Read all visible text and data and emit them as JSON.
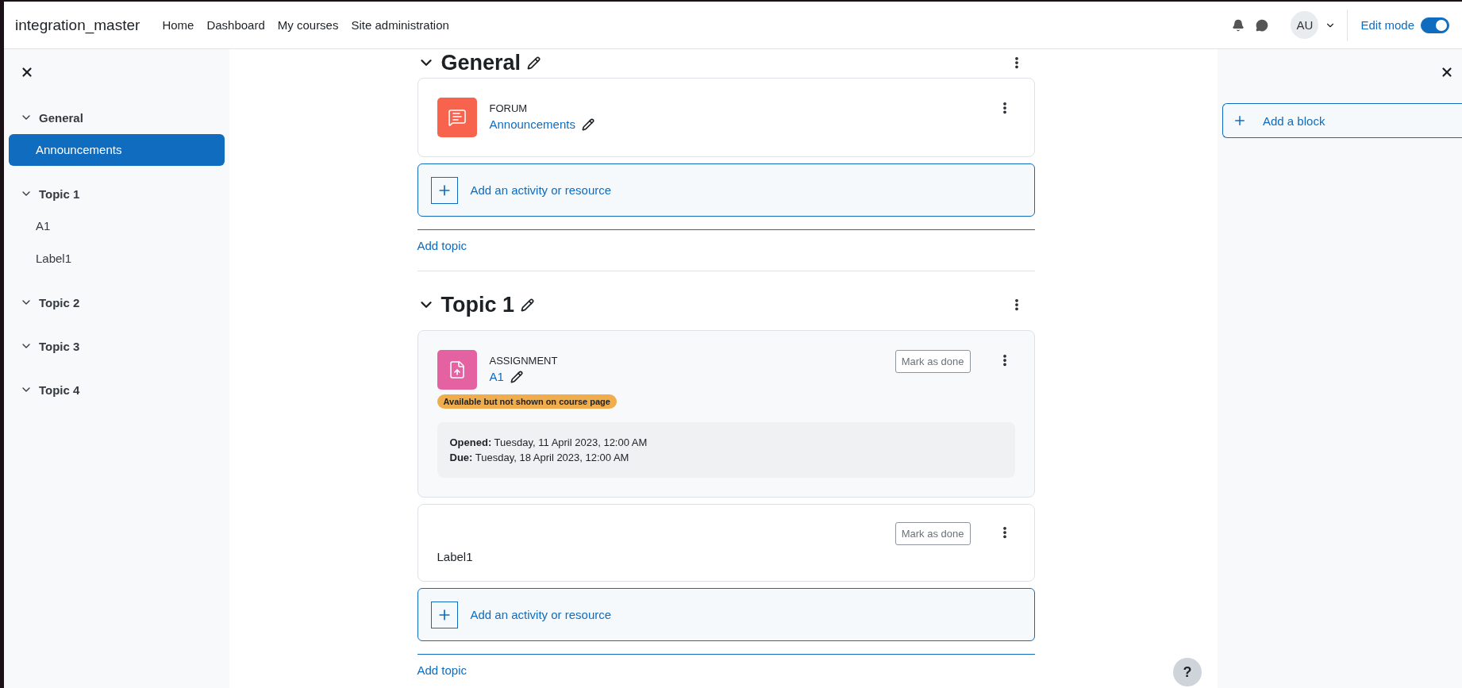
{
  "navbar": {
    "site_name": "integration_master",
    "links": [
      "Home",
      "Dashboard",
      "My courses",
      "Site administration"
    ],
    "avatar": "AU",
    "edit_mode": {
      "label": "Edit mode",
      "on": true
    }
  },
  "course_index": {
    "items": [
      {
        "label": "General",
        "expanded": true,
        "selected": false,
        "children": [
          {
            "label": "Announcements",
            "selected": true
          }
        ]
      },
      {
        "label": "Topic 1",
        "expanded": true,
        "selected": false,
        "children": [
          {
            "label": "A1",
            "selected": false
          },
          {
            "label": "Label1",
            "selected": false
          }
        ]
      },
      {
        "label": "Topic 2",
        "expanded": true,
        "selected": false
      },
      {
        "label": "Topic 3",
        "expanded": true,
        "selected": false
      },
      {
        "label": "Topic 4",
        "expanded": true,
        "selected": false
      }
    ]
  },
  "sections": [
    {
      "title": "General",
      "expanded": true,
      "activities": [
        {
          "kind": "forum",
          "type_label": "FORUM",
          "name": "Announcements"
        }
      ],
      "add_activity": "Add an activity or resource",
      "add_topic": "Add topic"
    },
    {
      "title": "Topic 1",
      "expanded": true,
      "activities": [
        {
          "kind": "assignment",
          "type_label": "ASSIGNMENT",
          "name": "A1",
          "mark_done": "Mark as done",
          "badge": "Available but not shown on course page",
          "dates": [
            "**Opened:** Tuesday, 11 April 2023, 12:00 AM",
            "**Due:** Tuesday, 18 April 2023, 12:00 AM"
          ]
        },
        {
          "kind": "label",
          "text": "Label1",
          "mark_done": "Mark as done"
        }
      ],
      "add_activity": "Add an activity or resource",
      "add_topic": "Add topic"
    }
  ],
  "blocks_drawer": {
    "add_block": "Add a block"
  },
  "help": "?"
}
